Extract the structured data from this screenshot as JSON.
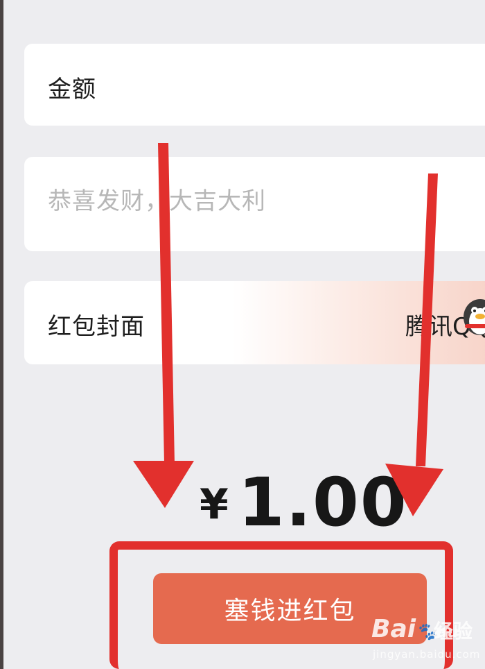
{
  "form": {
    "amount_label": "金额",
    "greeting_placeholder": "恭喜发财，大吉大利",
    "cover_label": "红包封面",
    "cover_value": "腾讯QQ"
  },
  "summary": {
    "currency_symbol": "¥",
    "amount": "1.00"
  },
  "actions": {
    "send_label": "塞钱进红包"
  },
  "watermark": {
    "logo": "Bai",
    "logo_sub": "du",
    "text": "经验",
    "url": "jingyan.baidu.com"
  },
  "colors": {
    "send_button": "#e56a4f",
    "annotation_red": "#e2302d",
    "background": "#ededf0"
  }
}
